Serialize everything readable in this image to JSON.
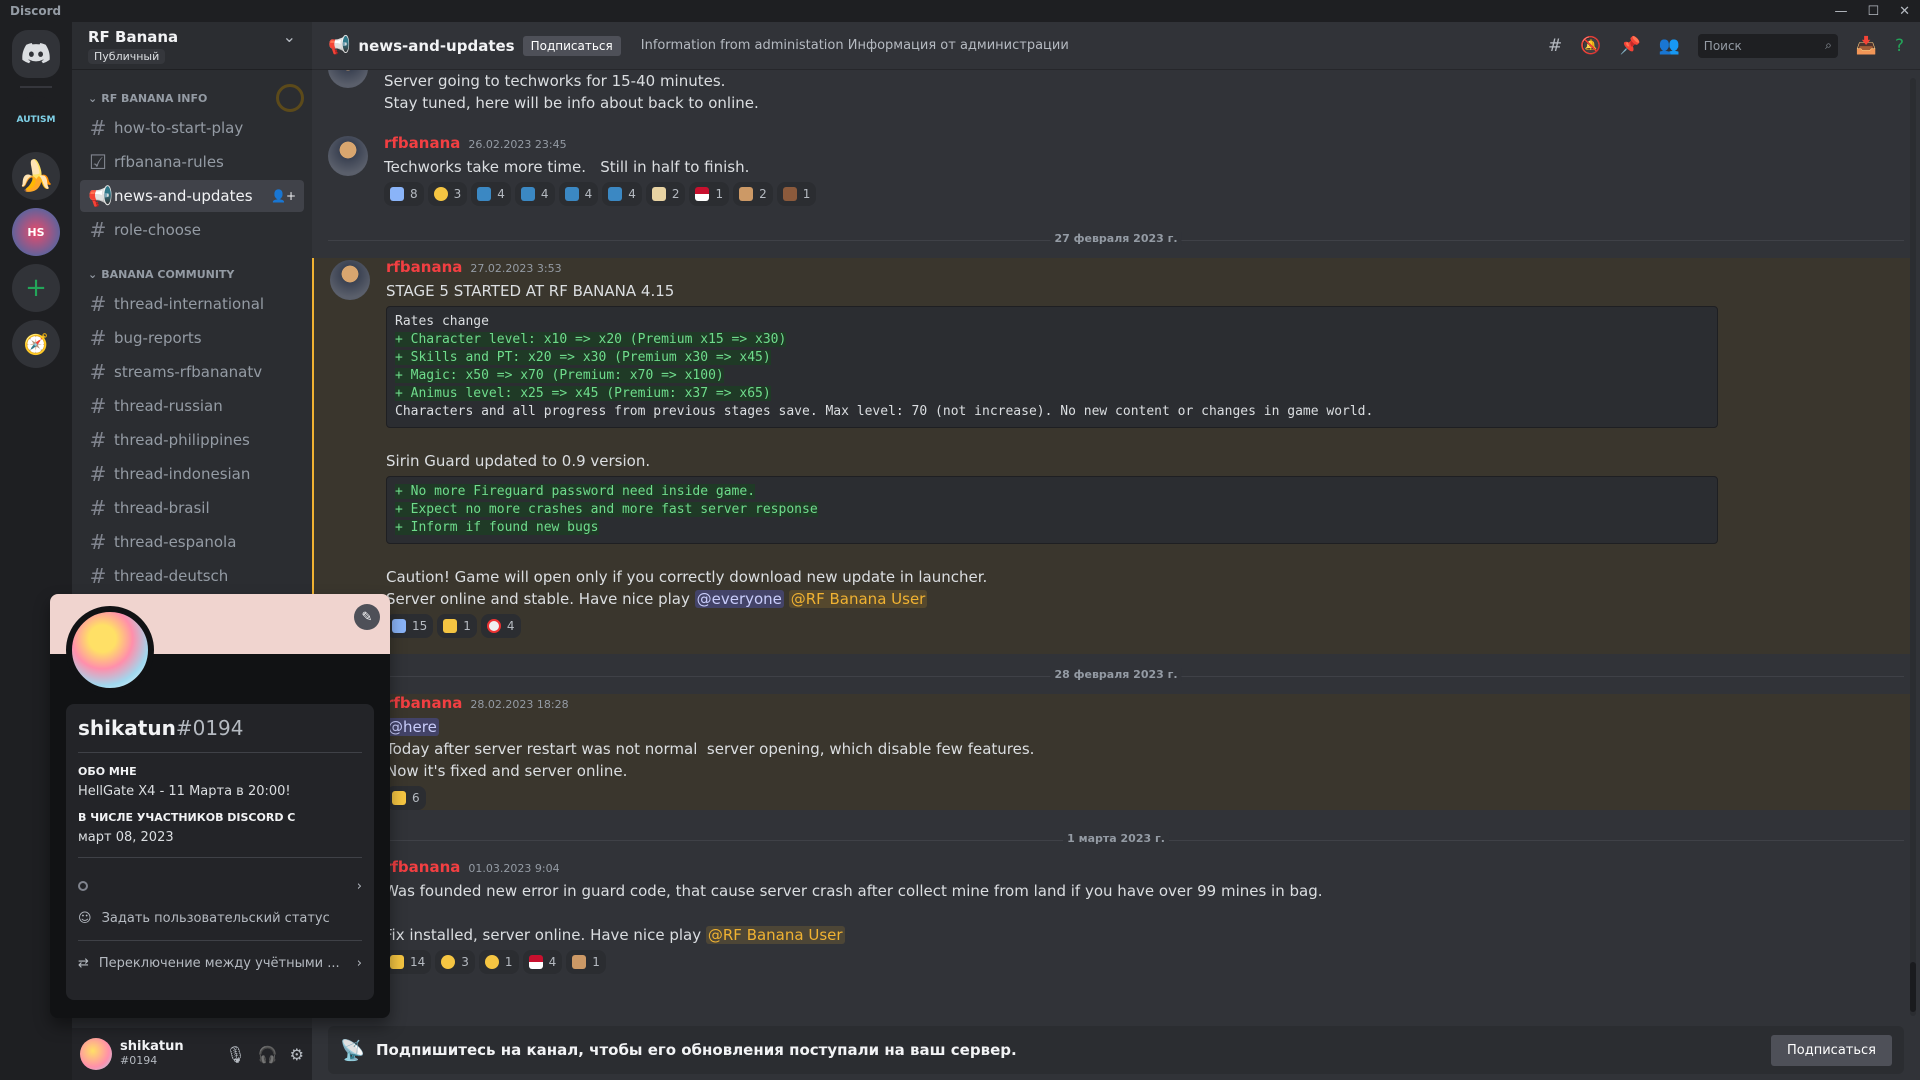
{
  "window": {
    "title": "Discord"
  },
  "servers": [
    {
      "name": "home-icon"
    },
    {
      "label": "AUTISM"
    },
    {
      "label": "RF Banana"
    },
    {
      "label": "HS"
    }
  ],
  "guild": {
    "name": "RF Banana",
    "badge": "Публичный"
  },
  "categories": {
    "info": "RF BANANA INFO",
    "community": "BANANA COMMUNITY"
  },
  "channels_info": [
    {
      "name": "how-to-start-play"
    },
    {
      "name": "rfbanana-rules"
    },
    {
      "name": "news-and-updates"
    },
    {
      "name": "role-choose"
    }
  ],
  "channels_community": [
    {
      "name": "thread-international"
    },
    {
      "name": "bug-reports"
    },
    {
      "name": "streams-rfbananatv"
    },
    {
      "name": "thread-russian"
    },
    {
      "name": "thread-philippines"
    },
    {
      "name": "thread-indonesian"
    },
    {
      "name": "thread-brasil"
    },
    {
      "name": "thread-espanola"
    },
    {
      "name": "thread-deutsch"
    }
  ],
  "topbar": {
    "channel": "news-and-updates",
    "follow": "Подписаться",
    "topic": "Information from administation Информация от администрации",
    "search_placeholder": "Поиск"
  },
  "messages": {
    "m0": {
      "lines": [
        "Server going to techworks for 15-40 minutes.",
        "Stay tuned, here will be info about back to online."
      ]
    },
    "m1": {
      "author": "rfbanana",
      "time": "26.02.2023 23:45",
      "line": "Techworks take more time.   Still in half to finish.",
      "reactions": [
        "8",
        "3",
        "4",
        "4",
        "4",
        "4",
        "2",
        "1",
        "2",
        "1"
      ]
    },
    "d1": "27 февраля 2023 г.",
    "m2": {
      "author": "rfbanana",
      "time": "27.02.2023 3:53",
      "title": "STAGE 5 STARTED AT RF BANANA 4.15",
      "code1": {
        "first": "Rates change",
        "adds": [
          "+ Character level: x10 => x20 (Premium x15 => x30)",
          "+ Skills and PT: x20 => x30 (Premium x30 => x45)",
          "+ Magic: x50 => x70 (Premium: x70 => x100)",
          "+ Animus level: x25 => x45 (Premium: x37 => x65)"
        ],
        "last": "Characters and all progress from previous stages save. Max level: 70 (not increase). No new content or changes in game world."
      },
      "sirin": "Sirin Guard updated to 0.9 version.",
      "code2": [
        "+ No more Fireguard password need inside game.",
        "+ Expect no more crashes and more fast server response",
        "+ Inform if found new bugs"
      ],
      "caution": "Caution! Game will open only if you correctly download new update in launcher.",
      "online": "Server online and stable. Have nice play ",
      "mention_everyone": "@everyone",
      "mention_role": "@RF Banana User",
      "reactions": [
        "15",
        "1",
        "4"
      ]
    },
    "d2": "28 февраля 2023 г.",
    "m3": {
      "author": "rfbanana",
      "time": "28.02.2023 18:28",
      "mention": "@here",
      "lines": [
        "Today after server restart was not normal  server opening, which disable few features.",
        "Now it's fixed and server online."
      ],
      "reactions": [
        "6"
      ]
    },
    "d3": "1 марта 2023 г.",
    "m4": {
      "author": "rfbanana",
      "time": "01.03.2023 9:04",
      "line1": "Was founded new error in guard code, that cause server crash after collect mine from land if you have over 99 mines in bag.",
      "line2": "Fix installed, server online. Have nice play ",
      "mention_role": "@RF Banana User",
      "reactions": [
        "14",
        "3",
        "1",
        "4",
        "1"
      ]
    }
  },
  "follow_bar": {
    "text": "Подпишитесь на канал, чтобы его обновления поступали на ваш сервер.",
    "button": "Подписаться"
  },
  "profile": {
    "name": "shikatun",
    "disc": "#0194",
    "about_h": "ОБО МНЕ",
    "about": "HellGate X4 - 11 Марта в 20:00!",
    "member_h": "В ЧИСЛЕ УЧАСТНИКОВ DISCORD С",
    "member": "март 08, 2023",
    "custom_status": "Задать пользовательский статус",
    "switch": "Переключение между учётными ..."
  },
  "user": {
    "name": "shikatun",
    "tag": "#0194"
  },
  "colors": {
    "accent": "#f23f42",
    "role": "#f0b232",
    "online": "#23a559"
  }
}
